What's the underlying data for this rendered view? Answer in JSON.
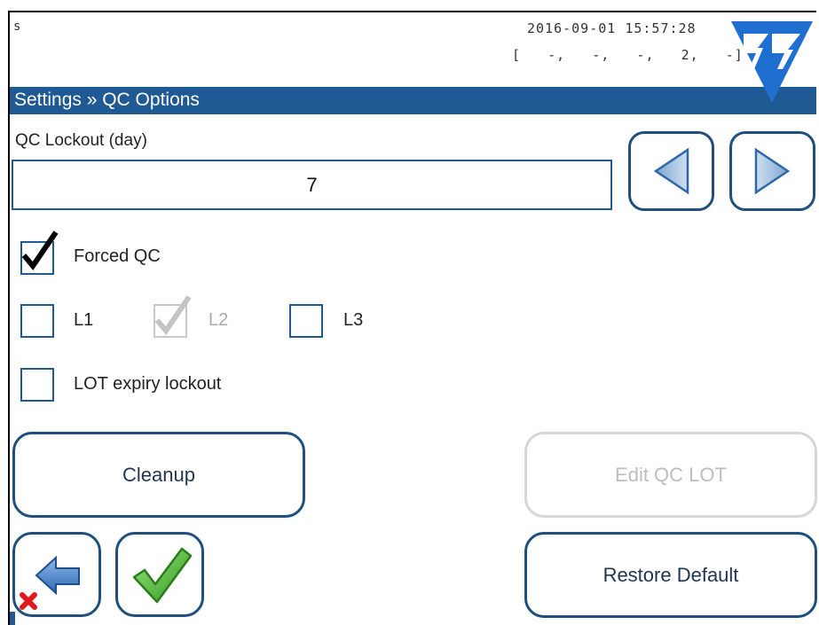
{
  "header": {
    "user": "s",
    "datetime": "2016-09-01 15:57:28",
    "status": "[   -,   -,   -,   2,   -]"
  },
  "title": "Settings » QC Options",
  "lockout": {
    "label": "QC Lockout (day)",
    "value": "7"
  },
  "checkboxes": {
    "forced_qc": {
      "label": "Forced QC",
      "checked": true
    },
    "l1": {
      "label": "L1",
      "checked": false
    },
    "l2": {
      "label": "L2",
      "checked": true,
      "disabled": true
    },
    "l3": {
      "label": "L3",
      "checked": false
    },
    "lot_expiry": {
      "label": "LOT expiry lockout",
      "checked": false
    }
  },
  "buttons": {
    "cleanup": "Cleanup",
    "edit_qc_lot": "Edit QC LOT",
    "restore_default": "Restore Default"
  },
  "colors": {
    "accent": "#1f5a94",
    "button_border": "#1f4f7f",
    "ok_green": "#3fae2a",
    "cancel_red": "#e01b1b"
  },
  "icons": {
    "logo": "77-logo-icon",
    "decrement": "triangle-left-icon",
    "increment": "triangle-right-icon",
    "back": "back-arrow-cancel-icon",
    "ok": "checkmark-icon"
  }
}
